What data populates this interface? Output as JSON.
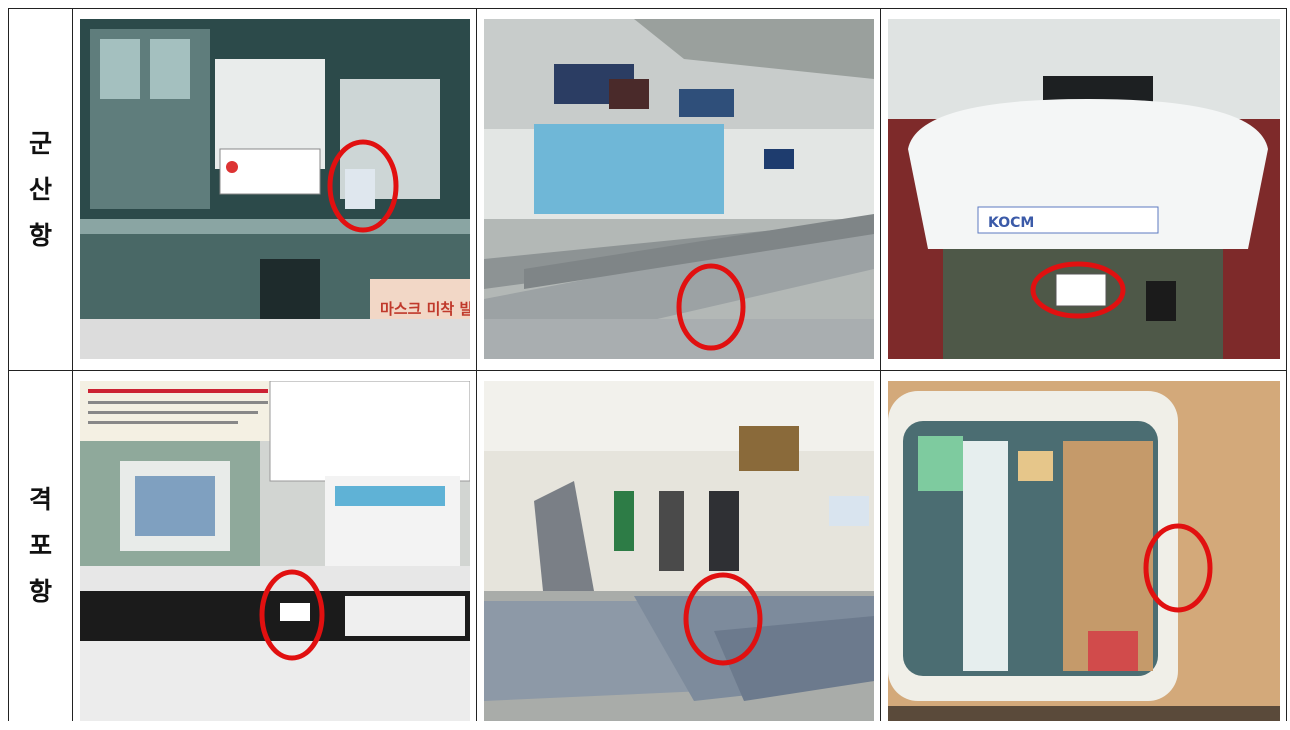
{
  "rows": [
    {
      "label": "군산항",
      "photos": [
        {
          "alt": "ticket-counter-window",
          "sign_text": "마스크 미착 발권 불"
        },
        {
          "alt": "waiting-hall-seats"
        },
        {
          "alt": "ferry-seat-headrest",
          "cover_text": "KOCM"
        }
      ]
    },
    {
      "label": "격포항",
      "photos": [
        {
          "alt": "counter-notice-board"
        },
        {
          "alt": "terminal-lobby-seats"
        },
        {
          "alt": "ship-cabin-window"
        }
      ]
    }
  ],
  "colors": {
    "highlight_circle": "#e11010",
    "border": "#222222"
  }
}
